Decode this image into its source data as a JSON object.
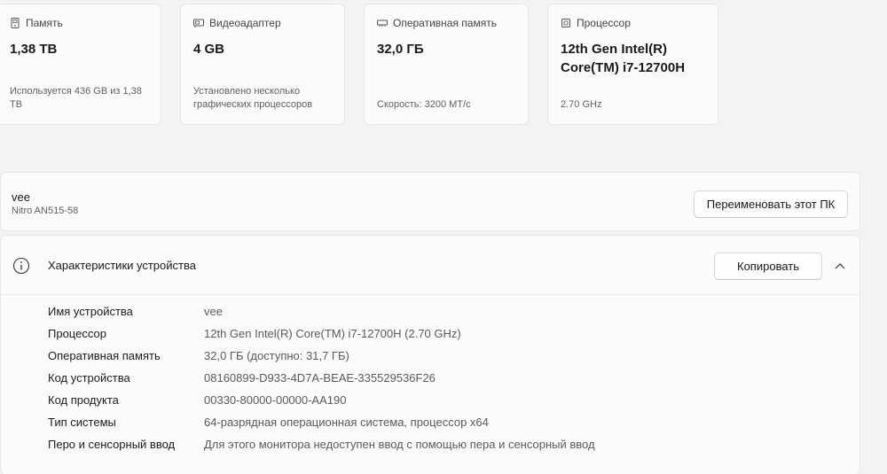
{
  "cards": [
    {
      "icon": "storage-icon",
      "label": "Память",
      "value": "1,38 TB",
      "sub": "Используется 436 GB из 1,38 TB"
    },
    {
      "icon": "gpu-icon",
      "label": "Видеоадаптер",
      "value": "4 GB",
      "sub": "Установлено несколько графических процессоров"
    },
    {
      "icon": "ram-icon",
      "label": "Оперативная память",
      "value": "32,0 ГБ",
      "sub": "Скорость: 3200 MT/с"
    },
    {
      "icon": "cpu-icon",
      "label": "Процессор",
      "value": "12th Gen Intel(R) Core(TM) i7-12700H",
      "sub": "2.70 GHz"
    }
  ],
  "pc": {
    "name": "vee",
    "model": "Nitro AN515-58",
    "rename_label": "Переименовать этот ПК"
  },
  "specs": {
    "title": "Характеристики устройства",
    "copy_label": "Копировать",
    "rows": [
      {
        "key": "Имя устройства",
        "value": "vee"
      },
      {
        "key": "Процессор",
        "value": "12th Gen Intel(R) Core(TM) i7-12700H (2.70 GHz)"
      },
      {
        "key": "Оперативная память",
        "value": "32,0 ГБ (доступно: 31,7 ГБ)"
      },
      {
        "key": "Код устройства",
        "value": "08160899-D933-4D7A-BEAE-335529536F26"
      },
      {
        "key": "Код продукта",
        "value": "00330-80000-00000-AA190"
      },
      {
        "key": "Тип системы",
        "value": "64-разрядная операционная система, процессор x64"
      },
      {
        "key": "Перо и сенсорный ввод",
        "value": "Для этого монитора недоступен ввод с помощью пера и сенсорный ввод"
      }
    ]
  }
}
